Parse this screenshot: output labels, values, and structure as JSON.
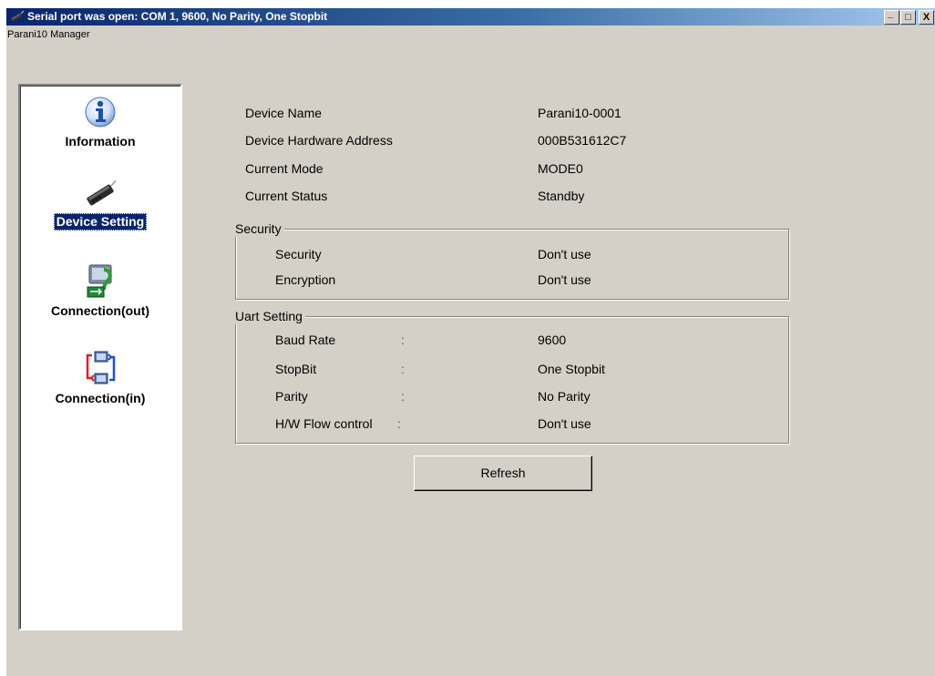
{
  "window": {
    "title": "Serial port was open: COM 1, 9600, No Parity, One Stopbit",
    "controls": {
      "minimize": "_",
      "maximize": "□",
      "close": "X"
    }
  },
  "menubar": {
    "label": "Parani10 Manager"
  },
  "sidebar": {
    "items": [
      {
        "label": "Information",
        "icon": "info-icon",
        "selected": false
      },
      {
        "label": "Device Setting",
        "icon": "device-icon",
        "selected": true
      },
      {
        "label": "Connection(out)",
        "icon": "connection-out-icon",
        "selected": false
      },
      {
        "label": "Connection(in)",
        "icon": "connection-in-icon",
        "selected": false
      }
    ]
  },
  "device": {
    "name_label": "Device Name",
    "name_value": "Parani10-0001",
    "address_label": "Device Hardware Address",
    "address_value": "000B531612C7",
    "mode_label": "Current Mode",
    "mode_value": "MODE0",
    "status_label": "Current Status",
    "status_value": "Standby"
  },
  "security": {
    "title": "Security",
    "security_label": "Security",
    "security_value": "Don't use",
    "encryption_label": "Encryption",
    "encryption_value": "Don't use"
  },
  "uart": {
    "title": "Uart Setting",
    "baud_label": "Baud Rate",
    "baud_colon": ":",
    "baud_value": "9600",
    "stopbit_label": "StopBit",
    "stopbit_colon": ":",
    "stopbit_value": "One Stopbit",
    "parity_label": "Parity",
    "parity_colon": ":",
    "parity_value": "No Parity",
    "flow_label": "H/W Flow control",
    "flow_colon": ":",
    "flow_value": "Don't use"
  },
  "actions": {
    "refresh_label": "Refresh"
  },
  "colors": {
    "titlebar_start": "#0a246a",
    "titlebar_end": "#a6caf0",
    "window_bg": "#d4d0c8",
    "selection": "#0a246a"
  }
}
